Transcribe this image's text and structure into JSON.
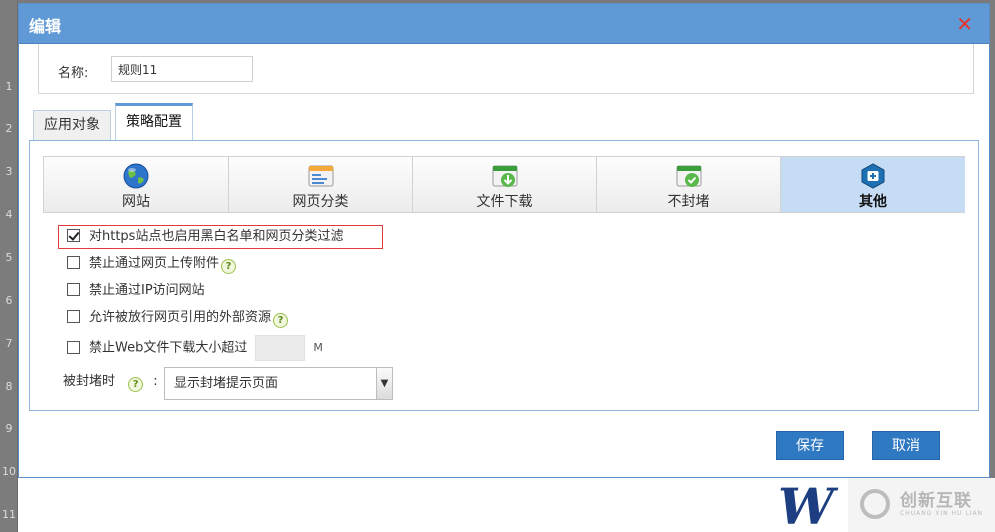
{
  "background": {
    "row_numbers": [
      "1",
      "2",
      "3",
      "4",
      "5",
      "6",
      "7",
      "8",
      "9",
      "10",
      "11"
    ]
  },
  "dialog": {
    "title": "编辑",
    "close_glyph": "✕",
    "name_label": "名称:",
    "name_value": "规则11",
    "tabs": [
      {
        "label": "应用对象",
        "active": false
      },
      {
        "label": "策略配置",
        "active": true
      }
    ],
    "categories": [
      {
        "label": "网站",
        "icon": "globe-icon",
        "active": false
      },
      {
        "label": "网页分类",
        "icon": "webpage-category-icon",
        "active": false
      },
      {
        "label": "文件下载",
        "icon": "file-download-icon",
        "active": false
      },
      {
        "label": "不封堵",
        "icon": "no-block-icon",
        "active": false
      },
      {
        "label": "其他",
        "icon": "other-settings-icon",
        "active": true
      }
    ],
    "options": [
      {
        "label": "对https站点也启用黑白名单和网页分类过滤",
        "checked": true,
        "help": false
      },
      {
        "label": "禁止通过网页上传附件",
        "checked": false,
        "help": true
      },
      {
        "label": "禁止通过IP访问网站",
        "checked": false,
        "help": false
      },
      {
        "label": "允许被放行网页引用的外部资源",
        "checked": false,
        "help": true
      },
      {
        "label": "禁止Web文件下载大小超过",
        "checked": false,
        "help": false
      }
    ],
    "size_unit": "M",
    "size_value": "",
    "help_glyph": "?",
    "blocked_label": "被封堵时",
    "blocked_colon": ":",
    "blocked_select": "显示封堵提示页面",
    "save_button": "保存",
    "cancel_button": "取消"
  },
  "watermark": {
    "brand": "创新互联",
    "brand_sub": "CHUANG XIN HU LIAN",
    "letter": "W"
  },
  "colors": {
    "titlebar": "#5f99d6",
    "button": "#2f78c2",
    "active_category": "#c6dcf4",
    "highlight": "#e0393e"
  }
}
